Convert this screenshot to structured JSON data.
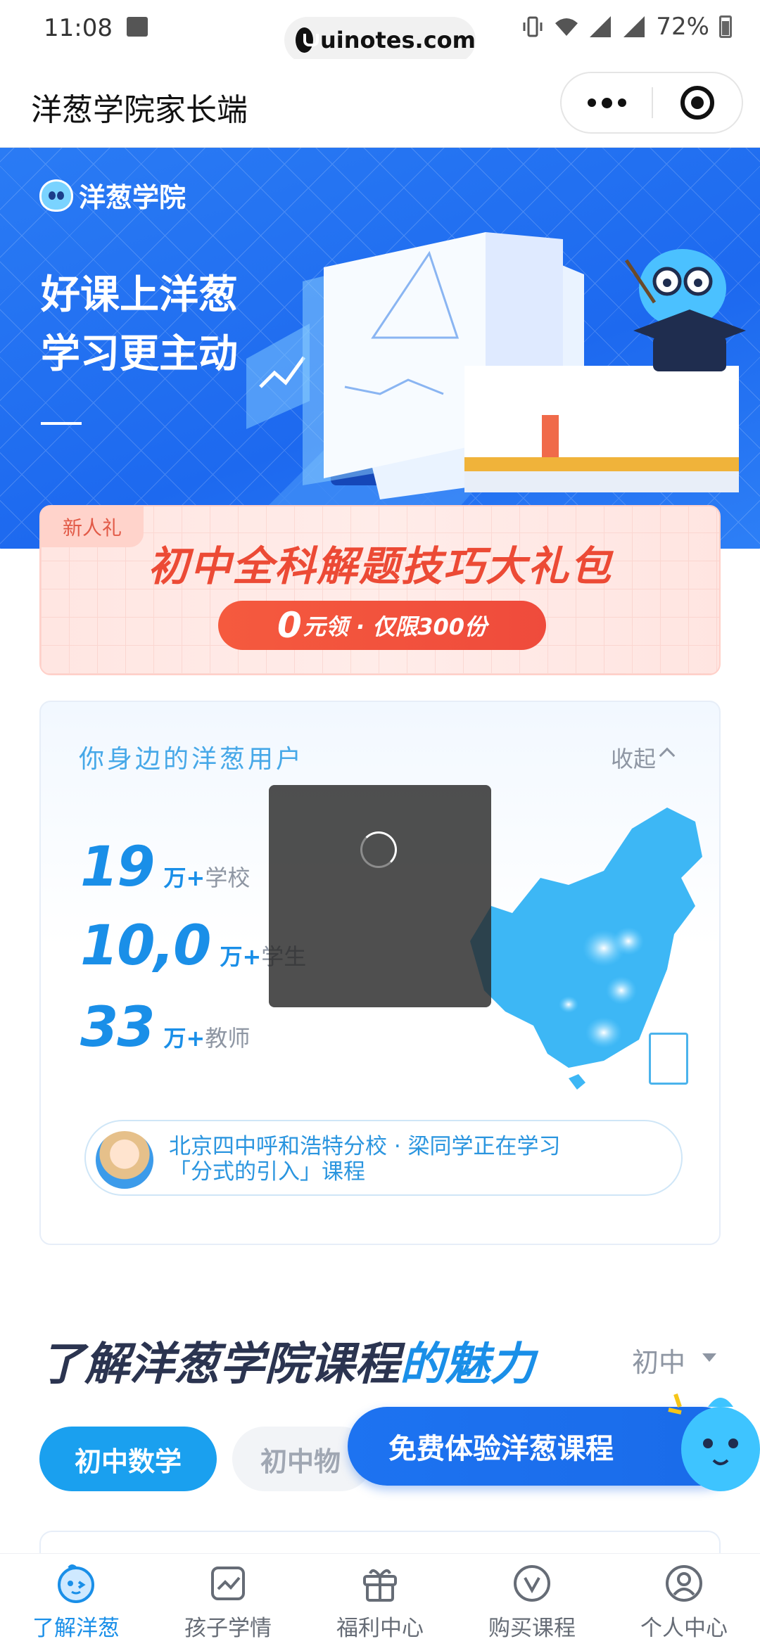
{
  "status_bar": {
    "time": "11:08",
    "url": "uinotes.com",
    "battery": "72%"
  },
  "nav": {
    "title": "洋葱学院家长端"
  },
  "hero": {
    "brand": "洋葱学院",
    "slogan_line1": "好课上洋葱",
    "slogan_line2": "学习更主动"
  },
  "gift": {
    "tag": "新人礼",
    "title": "初中全科解题技巧大礼包",
    "button_zero": "0",
    "button_rest": "元领 · 仅限300份"
  },
  "users": {
    "title": "你身边的洋葱用户",
    "collapse": "收起",
    "stats": [
      {
        "num": "19",
        "unit": "万+",
        "label": "学校"
      },
      {
        "num": "10,0",
        "unit": "万+",
        "label": "学生"
      },
      {
        "num": "33",
        "unit": "万+",
        "label": "教师"
      }
    ],
    "learner_line1": "北京四中呼和浩特分校 · 梁同学正在学习",
    "learner_line2": "「分式的引入」课程"
  },
  "section": {
    "title_main": "了解洋葱学院课程",
    "title_highlight": "的魅力",
    "grade": "初中",
    "tabs": [
      "初中数学",
      "初中物"
    ],
    "trial_button": "免费体验洋葱课程"
  },
  "tabbar": [
    {
      "label": "了解洋葱",
      "icon": "onion-face-icon",
      "active": true
    },
    {
      "label": "孩子学情",
      "icon": "chart-icon",
      "active": false
    },
    {
      "label": "福利中心",
      "icon": "gift-icon",
      "active": false
    },
    {
      "label": "购买课程",
      "icon": "v-badge-icon",
      "active": false
    },
    {
      "label": "个人中心",
      "icon": "user-icon",
      "active": false
    }
  ],
  "colors": {
    "brand_blue": "#1a8fe8",
    "hero_blue": "#1d69ef",
    "gift_red": "#ec4a35"
  }
}
